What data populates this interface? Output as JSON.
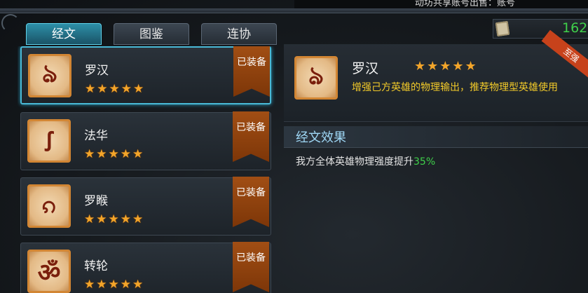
{
  "ticker": {
    "text": "动坊共享账号出售：账号"
  },
  "tabs": [
    {
      "label": "经文",
      "active": true
    },
    {
      "label": "图鉴",
      "active": false
    },
    {
      "label": "连协",
      "active": false
    }
  ],
  "currency": {
    "icon": "scroll-icon",
    "value": "162"
  },
  "scriptures": [
    {
      "name": "罗汉",
      "stars": "★★★★★",
      "status": "已装备",
      "glyph": "ঌ",
      "selected": true
    },
    {
      "name": "法华",
      "stars": "★★★★★",
      "status": "已装备",
      "glyph": "ꭍ",
      "selected": false
    },
    {
      "name": "罗睺",
      "stars": "★★★★★",
      "status": "已装备",
      "glyph": "ၵ",
      "selected": false
    },
    {
      "name": "转轮",
      "stars": "★★★★★",
      "status": "已装备",
      "glyph": "ॐ",
      "selected": false
    }
  ],
  "detail": {
    "name": "罗汉",
    "stars": "★★★★★",
    "description": "增强己方英雄的物理输出，推荐物理型英雄使用",
    "ribbon": "至强",
    "glyph": "ঌ"
  },
  "effect": {
    "title": "经文效果",
    "text": "我方全体英雄物理强度提升",
    "value": "35%"
  },
  "colors": {
    "accent": "#49b9d6",
    "gold": "#f3a52a",
    "green": "#3fd04a",
    "desc": "#f2ca29"
  }
}
